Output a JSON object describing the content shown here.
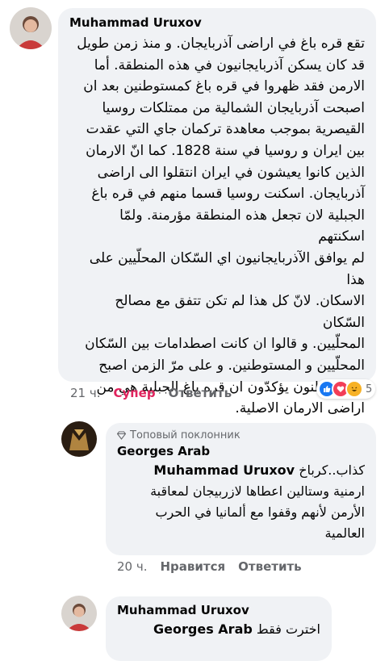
{
  "comments": [
    {
      "author": "Muhammad Uruxov",
      "text": "تقع  قره باغ في اراضی آذربایجان. و منذ زمن طويل\nقد كان يسكن آذربايجانيون في هذه المنطقة. أما\nالارمن فقد ظهروا في قره باغ كمستوطنين بعد ان\nاصبحت آذربايجان الشمالية من ممتلكات روسيا\nالقيصرية بموجب معاهدة تركمان جاي التي عقدت\nبين ايران و روسيا في سنة 1828. كما انّ الارمان\nالذين كانوا يعيشون في ايران انتقلوا الى اراضی\nآذربايجان. اسكنت روسيا قسما منهم في قره باغ\nالجبلية لان تجعل هذه المنطقة مؤرمنة. ولمّا اسكنتهم\nلم يوافق الآذربايجانيون اي السّكان المحلّيين على هذا\nالاسكان. لانّ كل هذا لم تكن تتفق مع مصالح السّكان\nالمحلّيين. و قالوا ان كانت اصطدامات بين السّكان\nالمحلّيين و المستوطنين. و على مرّ الزمن اصبح\nالمستوطنون يؤكدّون ان قره باغ الجبلية هي من\nاراضی الارمان الاصلية.",
      "time": "21 ч.",
      "reaction_label": "Супер",
      "reply_label": "Ответить",
      "reaction_count": "5"
    },
    {
      "badge": "Топовый поклонник",
      "author": "Georges Arab",
      "mention": "Muhammad Uruxov",
      "text_first": "كذاب..كرباخ",
      "text": "ارمنية وستالين اعطاها لازربيجان لمعاقبة\nالأرمن لأنهم وقفوا مع ألمانيا في الحرب\nالعالمية",
      "time": "20 ч.",
      "like_label": "Нравится",
      "reply_label": "Ответить"
    },
    {
      "author": "Muhammad Uruxov",
      "mention": "Georges Arab",
      "text_first": "اخترت فقط"
    }
  ],
  "colors": {
    "bubble": "#f0f2f5",
    "super": "#e0245e",
    "meta": "#65676b"
  },
  "icons": [
    "like-icon",
    "love-icon",
    "haha-icon",
    "diamond-icon"
  ]
}
